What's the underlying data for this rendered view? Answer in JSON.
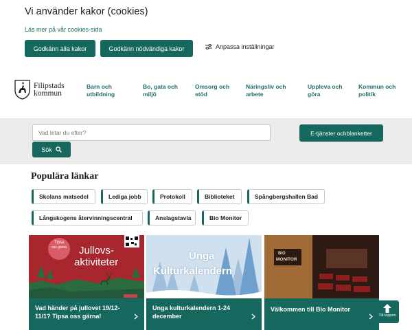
{
  "cookie": {
    "title": "Vi använder kakor (cookies)",
    "link": "Läs mer på vår cookies-sida",
    "accept_all": "Godkänn alla kakor",
    "accept_needed": "Godkänn nödvändiga kakor",
    "customize": "Anpassa inställningar"
  },
  "header": {
    "logo_line1": "Filipstads",
    "logo_line2": "kommun",
    "nav": [
      {
        "line1": "Barn och",
        "line2": "utbildning"
      },
      {
        "line1": "Bo, gata och",
        "line2": "miljö"
      },
      {
        "line1": "Omsorg och",
        "line2": "stöd"
      },
      {
        "line1": "Näringsliv och",
        "line2": "arbete"
      },
      {
        "line1": "Uppleva och",
        "line2": "göra"
      },
      {
        "line1": "Kommun och",
        "line2": "politik"
      }
    ]
  },
  "search": {
    "placeholder": "Vad letar du efter?",
    "button": "Sök",
    "eservices_line1": "E-tjänster och",
    "eservices_line2": "blanketter"
  },
  "popular": {
    "title": "Populära länkar",
    "links": [
      "Skolans matsedel",
      "Lediga jobb",
      "Protokoll",
      "Biblioteket",
      "Spångbergshallen Bad",
      "Långskogens återvinningscentral",
      "Anslagstavla",
      "Bio Monitor"
    ]
  },
  "cards": [
    {
      "img_title_1": "Jullovs-",
      "img_title_2": "aktiviteter",
      "badge_1": "Tipsa",
      "badge_2": "oss gärna",
      "text": "Vad händer på jullovet 19/12-11/1? Tipsa oss gärna!"
    },
    {
      "img_title_1": "Unga",
      "img_title_2": "Kulturkalendern",
      "text": "Unga kulturkalendern 1-24 december"
    },
    {
      "img_sign_1": "BIO",
      "img_sign_2": "MONITOR",
      "text": "Välkommen till Bio Monitor"
    }
  ],
  "to_top": "Till toppen",
  "colors": {
    "brand": "#16685f",
    "link": "#1f6f6a",
    "band": "#ececec"
  }
}
